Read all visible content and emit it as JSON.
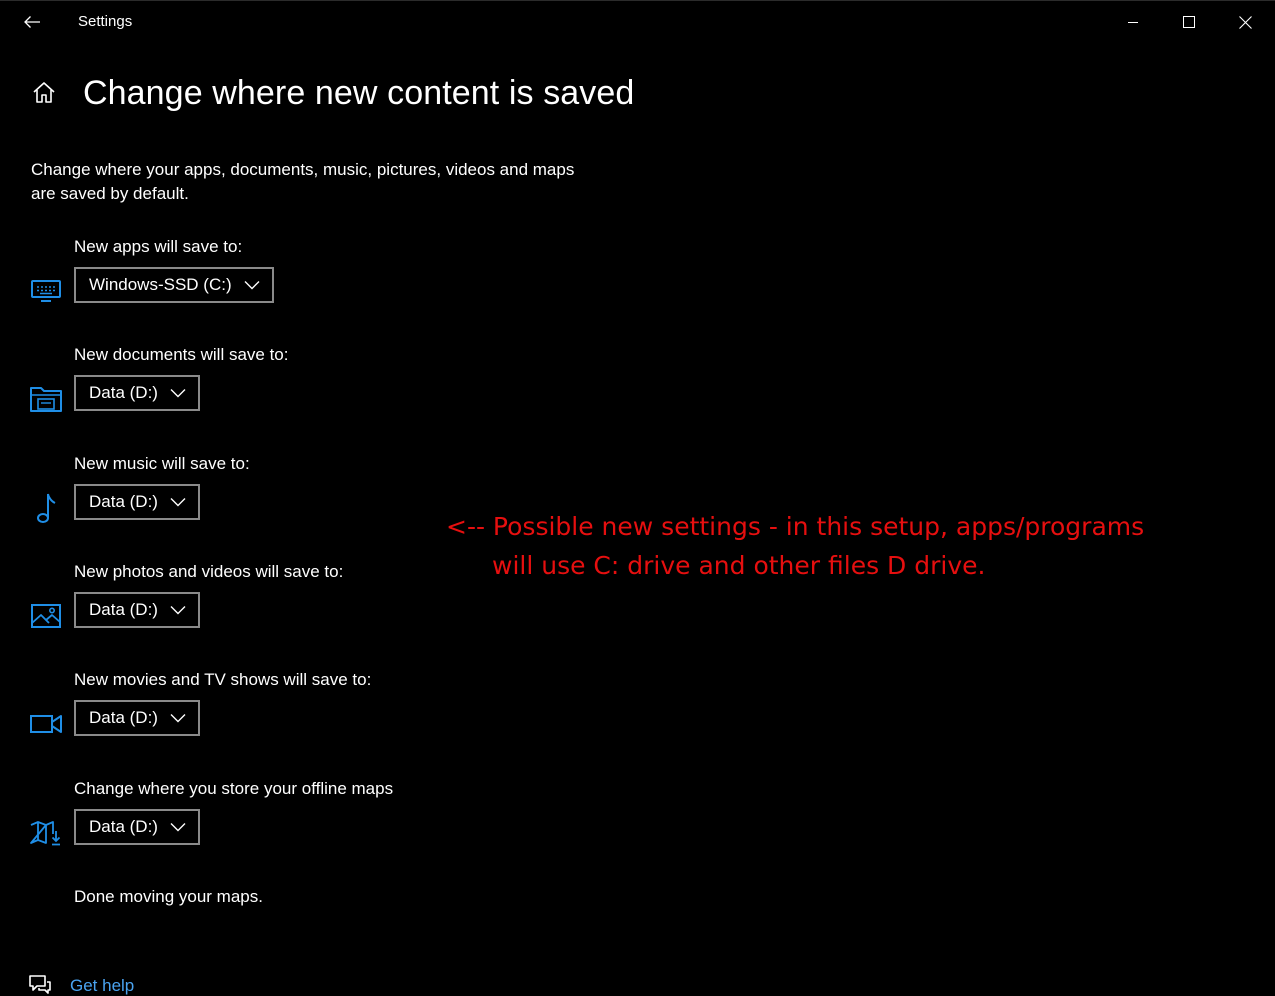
{
  "window": {
    "title": "Settings",
    "controls": [
      "minimize",
      "maximize",
      "close"
    ]
  },
  "header": {
    "title": "Change where new content is saved"
  },
  "description": "Change where your apps, documents, music, pictures, videos and maps are saved by default.",
  "settings": [
    {
      "label": "New apps will save to:",
      "value": "Windows-SSD (C:)",
      "icon": "monitor-icon"
    },
    {
      "label": "New documents will save to:",
      "value": "Data (D:)",
      "icon": "documents-folder-icon"
    },
    {
      "label": "New music will save to:",
      "value": "Data (D:)",
      "icon": "music-note-icon"
    },
    {
      "label": "New photos and videos will save to:",
      "value": "Data (D:)",
      "icon": "picture-icon"
    },
    {
      "label": "New movies and TV shows will save to:",
      "value": "Data (D:)",
      "icon": "video-camera-icon"
    },
    {
      "label": "Change where you store your offline maps",
      "value": "Data (D:)",
      "icon": "map-download-icon"
    }
  ],
  "status": "Done moving your maps.",
  "help": {
    "label": "Get help"
  },
  "annotation": {
    "line1": "<-- Possible new settings - in this setup, apps/programs",
    "line2": "will use C: drive and other files D drive."
  },
  "colors": {
    "background": "#000000",
    "accent": "#1f8ee6",
    "link": "#4aa3f0",
    "annotation": "#e60f0f",
    "dropdown_border": "#8a8a8a"
  }
}
